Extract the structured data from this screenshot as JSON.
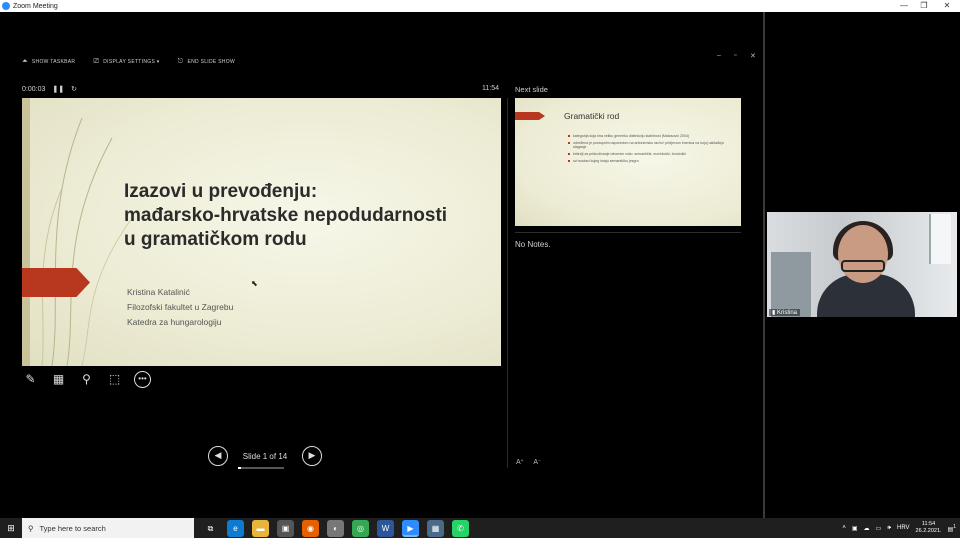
{
  "window": {
    "title": "Zoom Meeting",
    "minimize": "—",
    "maximize": "❐",
    "close": "✕"
  },
  "presenter_toolbar": {
    "show_taskbar": "SHOW TASKBAR",
    "display_settings": "DISPLAY SETTINGS ▾",
    "end_slide_show": "END SLIDE SHOW"
  },
  "timer": {
    "elapsed": "0:00:03",
    "pause": "❚❚",
    "reset": "↻",
    "clock": "11:54"
  },
  "current_slide": {
    "title_lines": [
      "Izazovi u prevođenju:",
      "mađarsko-hrvatske nepodudarnosti",
      "u gramatičkom rodu"
    ],
    "subtitle_lines": [
      "Kristina Katalinić",
      "Filozofski fakultet u Zagrebu",
      "Katedra za hungarologiju"
    ]
  },
  "next_slide": {
    "label": "Next slide",
    "title": "Gramatički rod",
    "bullets": [
      "kategorija koja ima veliku generiku distinkciju stabilnost (Matasović 2004)",
      "određena je postupnim usporedom na antonimsko razini i pridjevom imenica na kojoj usklađuju slaganje",
      "kriteriji za pridruživanje izbornim rodu: semantički, morfološki, fonološki",
      "svi sustavi kojeg imaju semantičku jezgru"
    ]
  },
  "notes": {
    "text": "No Notes."
  },
  "slide_nav": {
    "prev": "◀",
    "next": "▶",
    "counter": "Slide 1 of 14",
    "progress": 0.0714
  },
  "tools": [
    "pen-icon",
    "slides-grid-icon",
    "zoom-icon",
    "pointer-screen-icon",
    "more-icon"
  ],
  "participant": {
    "name": "Kristina"
  },
  "taskbar": {
    "search_placeholder": "Type here to search",
    "language": "HRV",
    "time": "11:54",
    "date": "26.2.2021.",
    "notification_count": "1"
  }
}
